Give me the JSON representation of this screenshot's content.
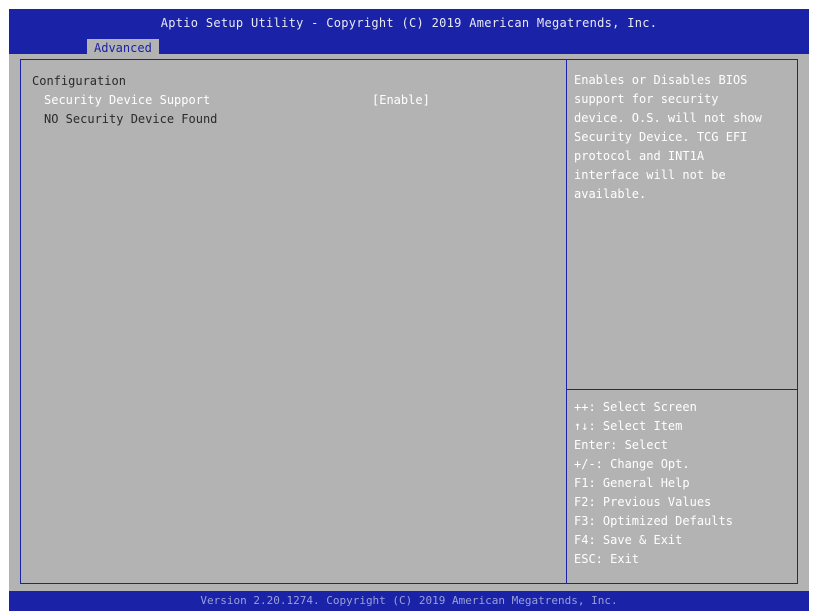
{
  "header": {
    "title": "Aptio Setup Utility - Copyright (C) 2019 American Megatrends, Inc.",
    "active_tab": "Advanced"
  },
  "main": {
    "section_title": "Configuration",
    "setting": {
      "label": "Security Device Support",
      "value": "[Enable]"
    },
    "status_line": "NO Security Device Found"
  },
  "help": {
    "description_lines": [
      "Enables or Disables BIOS",
      "support for security",
      "device. O.S. will not show",
      "Security Device. TCG EFI",
      "protocol and INT1A",
      "interface will not be",
      "available."
    ],
    "keys": [
      "++: Select Screen",
      "↑↓: Select Item",
      "Enter: Select",
      "+/-: Change Opt.",
      "F1: General Help",
      "F2: Previous Values",
      "F3: Optimized Defaults",
      "F4: Save & Exit",
      "ESC: Exit"
    ]
  },
  "footer": {
    "text": "Version 2.20.1274. Copyright (C) 2019 American Megatrends, Inc."
  },
  "colors": {
    "header_blue": "#1a22a8",
    "panel_gray": "#b3b3b3",
    "highlight_white": "#ffffff"
  }
}
